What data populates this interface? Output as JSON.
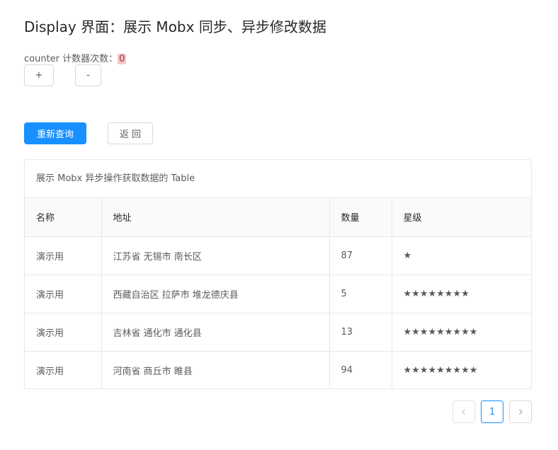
{
  "header": {
    "title": "Display 界面：展示 Mobx 同步、异步修改数据"
  },
  "counter": {
    "label": "counter 计数器次数：",
    "value": "0",
    "increment_label": "+",
    "decrement_label": "-"
  },
  "actions": {
    "requery_label": "重新查询",
    "back_label": "返回"
  },
  "table": {
    "caption": "展示 Mobx 异步操作获取数据的 Table",
    "columns": [
      "名称",
      "地址",
      "数量",
      "星级"
    ],
    "rows": [
      {
        "name": "演示用",
        "address": "江苏省 无锡市 南长区",
        "quantity": "87",
        "stars": "★"
      },
      {
        "name": "演示用",
        "address": "西藏自治区 拉萨市 堆龙德庆县",
        "quantity": "5",
        "stars": "★★★★★★★★"
      },
      {
        "name": "演示用",
        "address": "吉林省 通化市 通化县",
        "quantity": "13",
        "stars": "★★★★★★★★★"
      },
      {
        "name": "演示用",
        "address": "河南省 商丘市 睢县",
        "quantity": "94",
        "stars": "★★★★★★★★★"
      }
    ]
  },
  "pagination": {
    "current_page": "1",
    "prev_icon": "chevron-left-icon",
    "next_icon": "chevron-right-icon"
  },
  "colors": {
    "primary": "#1890ff",
    "counter_highlight": "#f4c6cc"
  }
}
